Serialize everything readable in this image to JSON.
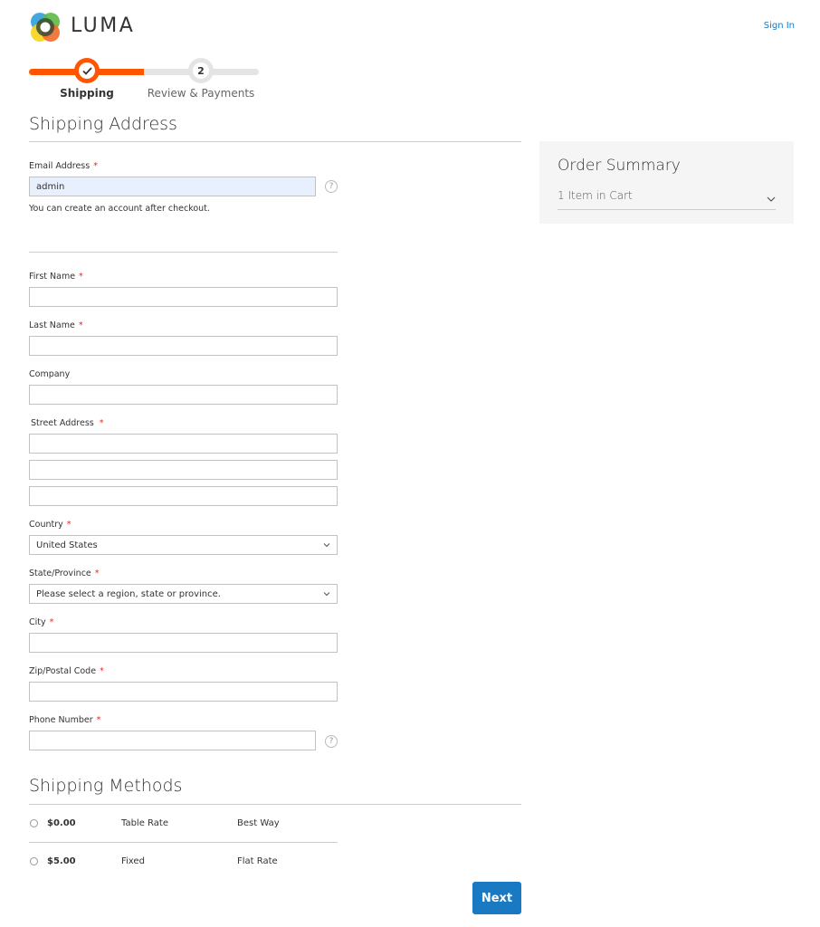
{
  "header": {
    "brand": "LUMA",
    "sign_in": "Sign In"
  },
  "progress": {
    "steps": [
      {
        "label": "Shipping",
        "state": "complete",
        "marker": "✓"
      },
      {
        "label": "Review & Payments",
        "state": "pending",
        "marker": "2"
      }
    ],
    "accent_color": "#ff5501"
  },
  "shipping_address": {
    "title": "Shipping Address",
    "email": {
      "label": "Email Address",
      "required": "*",
      "value": "admin",
      "note": "You can create an account after checkout."
    },
    "fields": {
      "first_name": {
        "label": "First Name",
        "required": "*",
        "value": ""
      },
      "last_name": {
        "label": "Last Name",
        "required": "*",
        "value": ""
      },
      "company": {
        "label": "Company",
        "value": ""
      },
      "street": {
        "label": "Street Address",
        "required": "*",
        "lines": [
          "",
          "",
          ""
        ]
      },
      "country": {
        "label": "Country",
        "required": "*",
        "selected": "United States"
      },
      "state": {
        "label": "State/Province",
        "required": "*",
        "selected": "Please select a region, state or province."
      },
      "city": {
        "label": "City",
        "required": "*",
        "value": ""
      },
      "zip": {
        "label": "Zip/Postal Code",
        "required": "*",
        "value": ""
      },
      "phone": {
        "label": "Phone Number",
        "required": "*",
        "value": ""
      }
    },
    "help_glyph": "?"
  },
  "order_summary": {
    "title": "Order Summary",
    "items_in_cart": "1 Item in Cart"
  },
  "shipping_methods": {
    "title": "Shipping Methods",
    "options": [
      {
        "price": "$0.00",
        "method": "Table Rate",
        "carrier": "Best Way",
        "selected": false
      },
      {
        "price": "$5.00",
        "method": "Fixed",
        "carrier": "Flat Rate",
        "selected": false
      }
    ]
  },
  "actions": {
    "next": "Next",
    "primary_color": "#1979c3"
  }
}
